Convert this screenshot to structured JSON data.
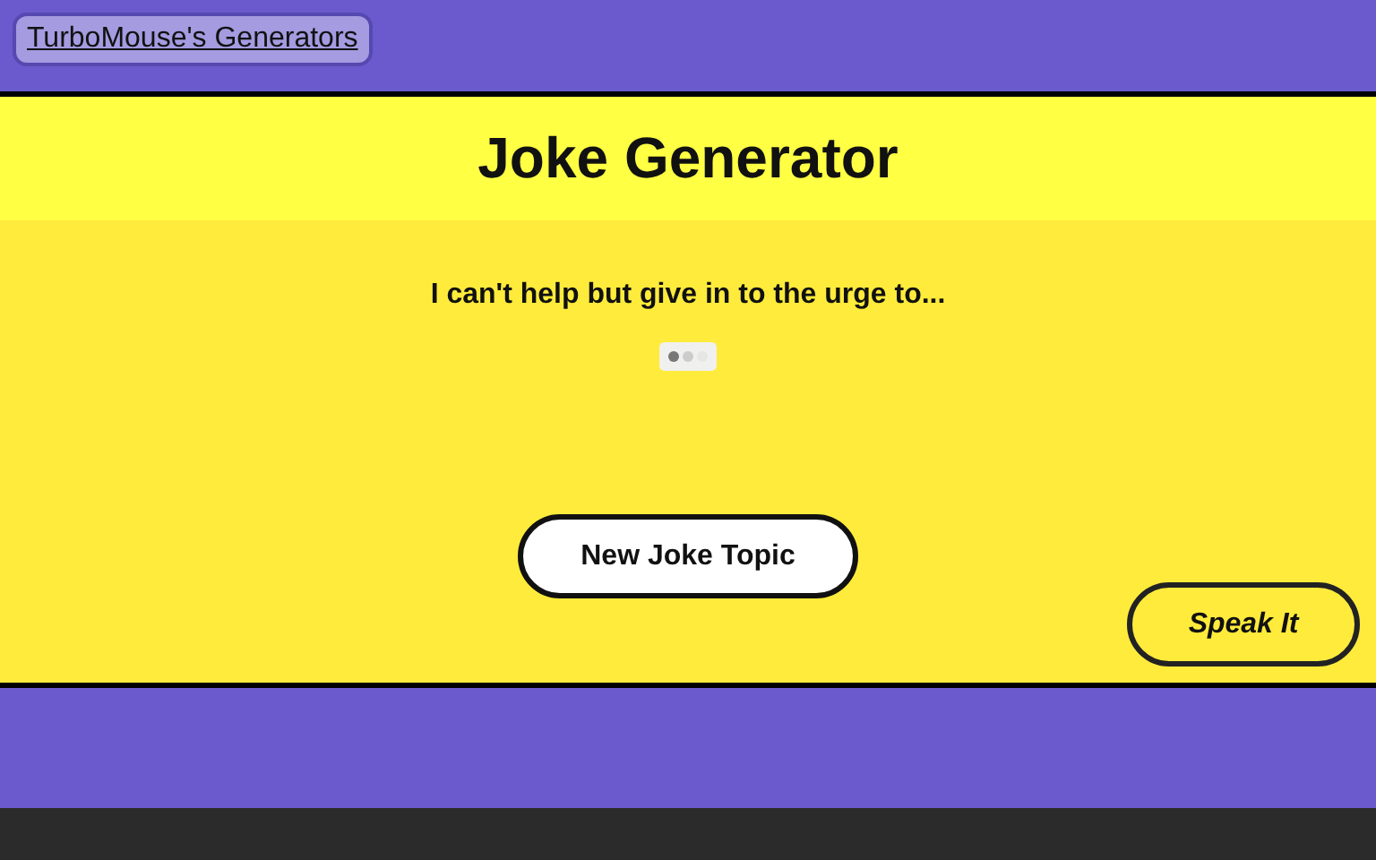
{
  "nav": {
    "link": "TurboMouse's Generators"
  },
  "header": {
    "title": "Joke Generator"
  },
  "joke": {
    "text": "I can't help but give in to the urge to..."
  },
  "buttons": {
    "new_topic": "New Joke Topic",
    "speak": "Speak It"
  }
}
